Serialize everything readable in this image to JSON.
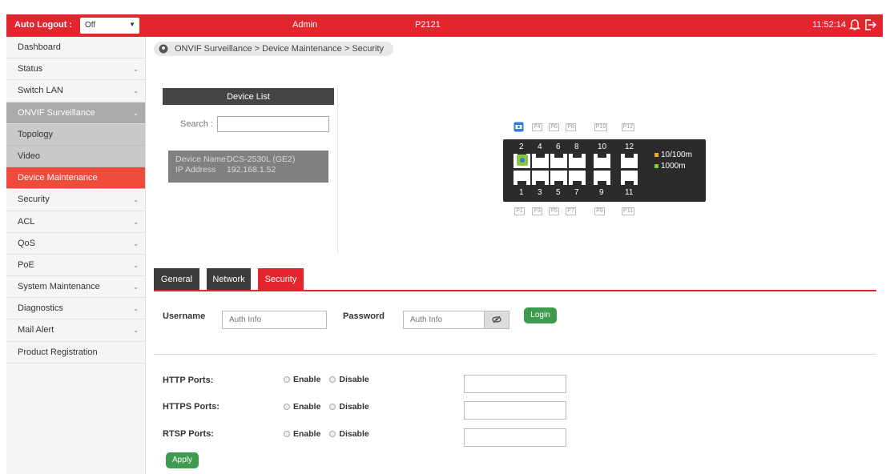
{
  "topbar": {
    "auto_logout_label": "Auto Logout :",
    "auto_logout_value": "Off",
    "user": "Admin",
    "model": "P2121",
    "time": "11:52:14"
  },
  "sidebar": {
    "items": [
      {
        "label": "Dashboard"
      },
      {
        "label": "Status"
      },
      {
        "label": "Switch LAN"
      },
      {
        "label": "ONVIF Surveillance"
      },
      {
        "label": "Topology"
      },
      {
        "label": "Video"
      },
      {
        "label": "Device Maintenance"
      },
      {
        "label": "Security"
      },
      {
        "label": "ACL"
      },
      {
        "label": "QoS"
      },
      {
        "label": "PoE"
      },
      {
        "label": "System Maintenance"
      },
      {
        "label": "Diagnostics"
      },
      {
        "label": "Mail Alert"
      },
      {
        "label": "Product Registration"
      }
    ]
  },
  "breadcrumb": "ONVIF Surveillance > Device Maintenance > Security",
  "device_list": {
    "title": "Device List",
    "search_label": "Search :",
    "device": {
      "name_key": "Device Name",
      "name_value": "DCS-2530L (GE2)",
      "ip_key": "IP Address",
      "ip_value": "192.168.1.52"
    }
  },
  "switch": {
    "top_port_labels": [
      "P4",
      "P6",
      "P8",
      "P10",
      "P12"
    ],
    "top_numbers": [
      "2",
      "4",
      "6",
      "8",
      "10",
      "12"
    ],
    "bottom_numbers": [
      "1",
      "3",
      "5",
      "7",
      "9",
      "11"
    ],
    "bottom_port_labels": [
      "P1",
      "P3",
      "P5",
      "P7",
      "P9",
      "P11"
    ],
    "legend": [
      {
        "label": "10/100m",
        "color": "#f5a623"
      },
      {
        "label": "1000m",
        "color": "#7ed321"
      }
    ]
  },
  "tabs": [
    {
      "label": "General"
    },
    {
      "label": "Network"
    },
    {
      "label": "Security"
    }
  ],
  "auth": {
    "username_label": "Username",
    "username_placeholder": "Auth Info",
    "password_label": "Password",
    "password_placeholder": "Auth Info",
    "login_label": "Login"
  },
  "ports": [
    {
      "label": "HTTP Ports:",
      "enable": "Enable",
      "disable": "Disable"
    },
    {
      "label": "HTTPS Ports:",
      "enable": "Enable",
      "disable": "Disable"
    },
    {
      "label": "RTSP Ports:",
      "enable": "Enable",
      "disable": "Disable"
    }
  ],
  "apply_label": "Apply",
  "colors": {
    "accent_red": "#e3262e",
    "active_item": "#f04a3d",
    "button_green": "#3e9a4e"
  }
}
